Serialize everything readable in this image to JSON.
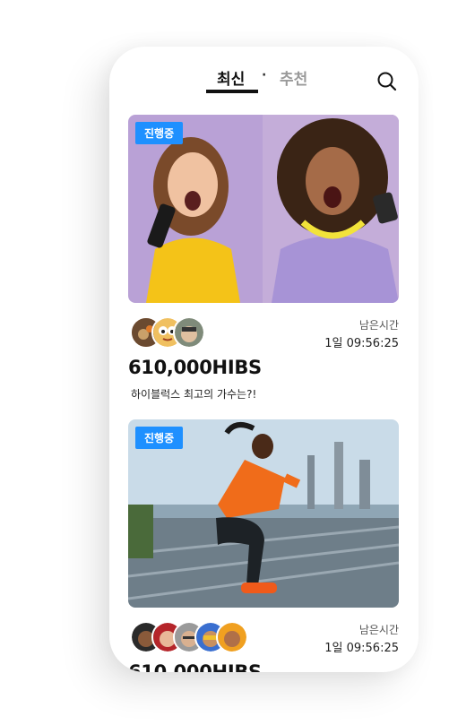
{
  "header": {
    "tab_latest": "최신",
    "separator": "·",
    "tab_recommended": "추천",
    "search_icon": "search-icon"
  },
  "cards": [
    {
      "status": "진행중",
      "remain_label": "남은시간",
      "remain_time": "1일 09:56:25",
      "amount": "610,000HIBS",
      "description": "하이블럭스 최고의 가수는?!"
    },
    {
      "status": "진행중",
      "remain_label": "남은시간",
      "remain_time": "1일 09:56:25",
      "amount": "610,000HIBS"
    }
  ],
  "colors": {
    "badge": "#1e90ff",
    "active_tab": "#111111",
    "inactive_tab": "#9a9a9a"
  }
}
